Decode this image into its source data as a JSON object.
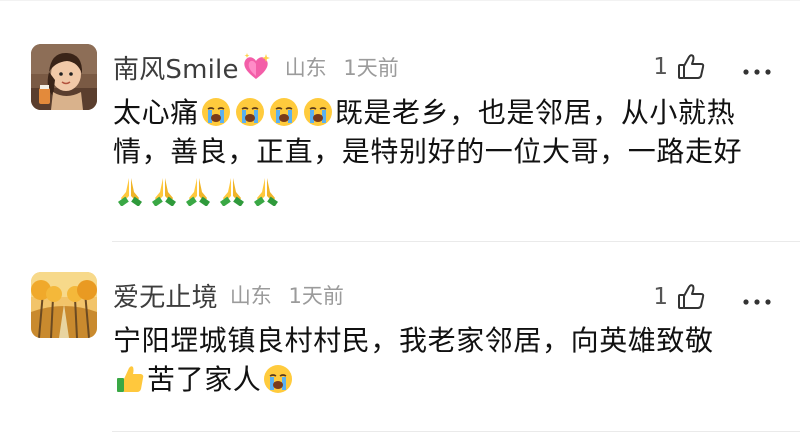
{
  "comments": [
    {
      "user": "南风Smile",
      "location": "山东",
      "time": "1天前",
      "likes": "1",
      "text_line1": "太心痛",
      "text_line1b": "既是老乡，也是邻居，从小就热",
      "text_line2": "情，善良，正直，是特别好的一位大哥，一路走好",
      "icons": [
        "sparkling-heart-icon",
        "crying-face-icon",
        "praying-hands-icon"
      ]
    },
    {
      "user": "爱无止境",
      "location": "山东",
      "time": "1天前",
      "likes": "1",
      "text_line1": "宁阳堽城镇良村村民，我老家邻居，向英雄致敬",
      "text_line2": "苦了家人",
      "icons": [
        "thumbs-up-icon",
        "crying-face-icon"
      ]
    }
  ]
}
